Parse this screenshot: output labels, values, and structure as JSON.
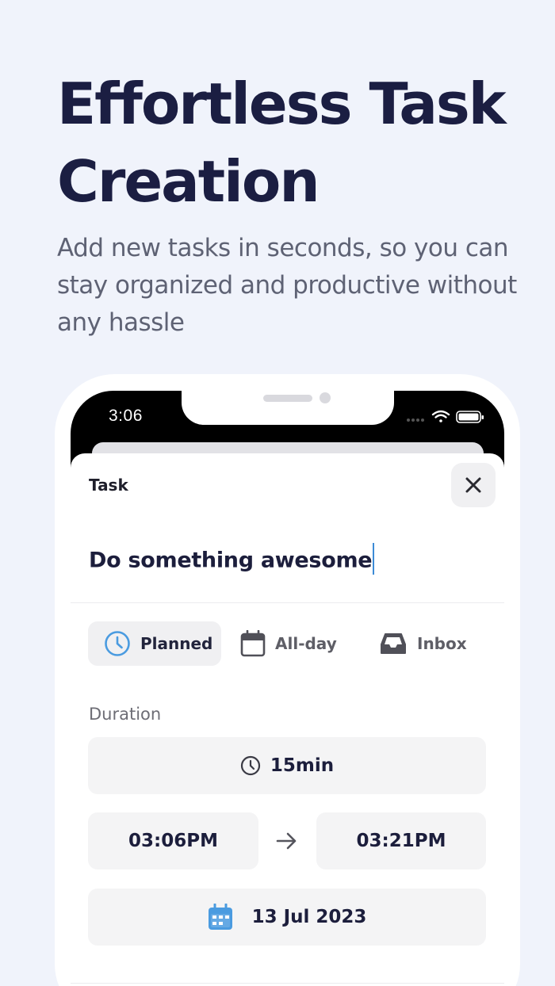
{
  "hero": {
    "title": "Effortless Task Creation",
    "subtitle": "Add new tasks in seconds, so you can stay organized and productive without any hassle"
  },
  "status_bar": {
    "time": "3:06"
  },
  "sheet": {
    "title": "Task",
    "task_name": "Do something awesome",
    "modes": [
      {
        "label": "Planned",
        "icon": "clock-icon",
        "active": true
      },
      {
        "label": "All-day",
        "icon": "calendar-icon",
        "active": false
      },
      {
        "label": "Inbox",
        "icon": "inbox-icon",
        "active": false
      }
    ],
    "duration_label": "Duration",
    "duration_value": "15min",
    "start_time": "03:06PM",
    "end_time": "03:21PM",
    "date": "13 Jul 2023"
  },
  "colors": {
    "background": "#f0f3fb",
    "title": "#1b1e42",
    "accent": "#4a9be0"
  }
}
